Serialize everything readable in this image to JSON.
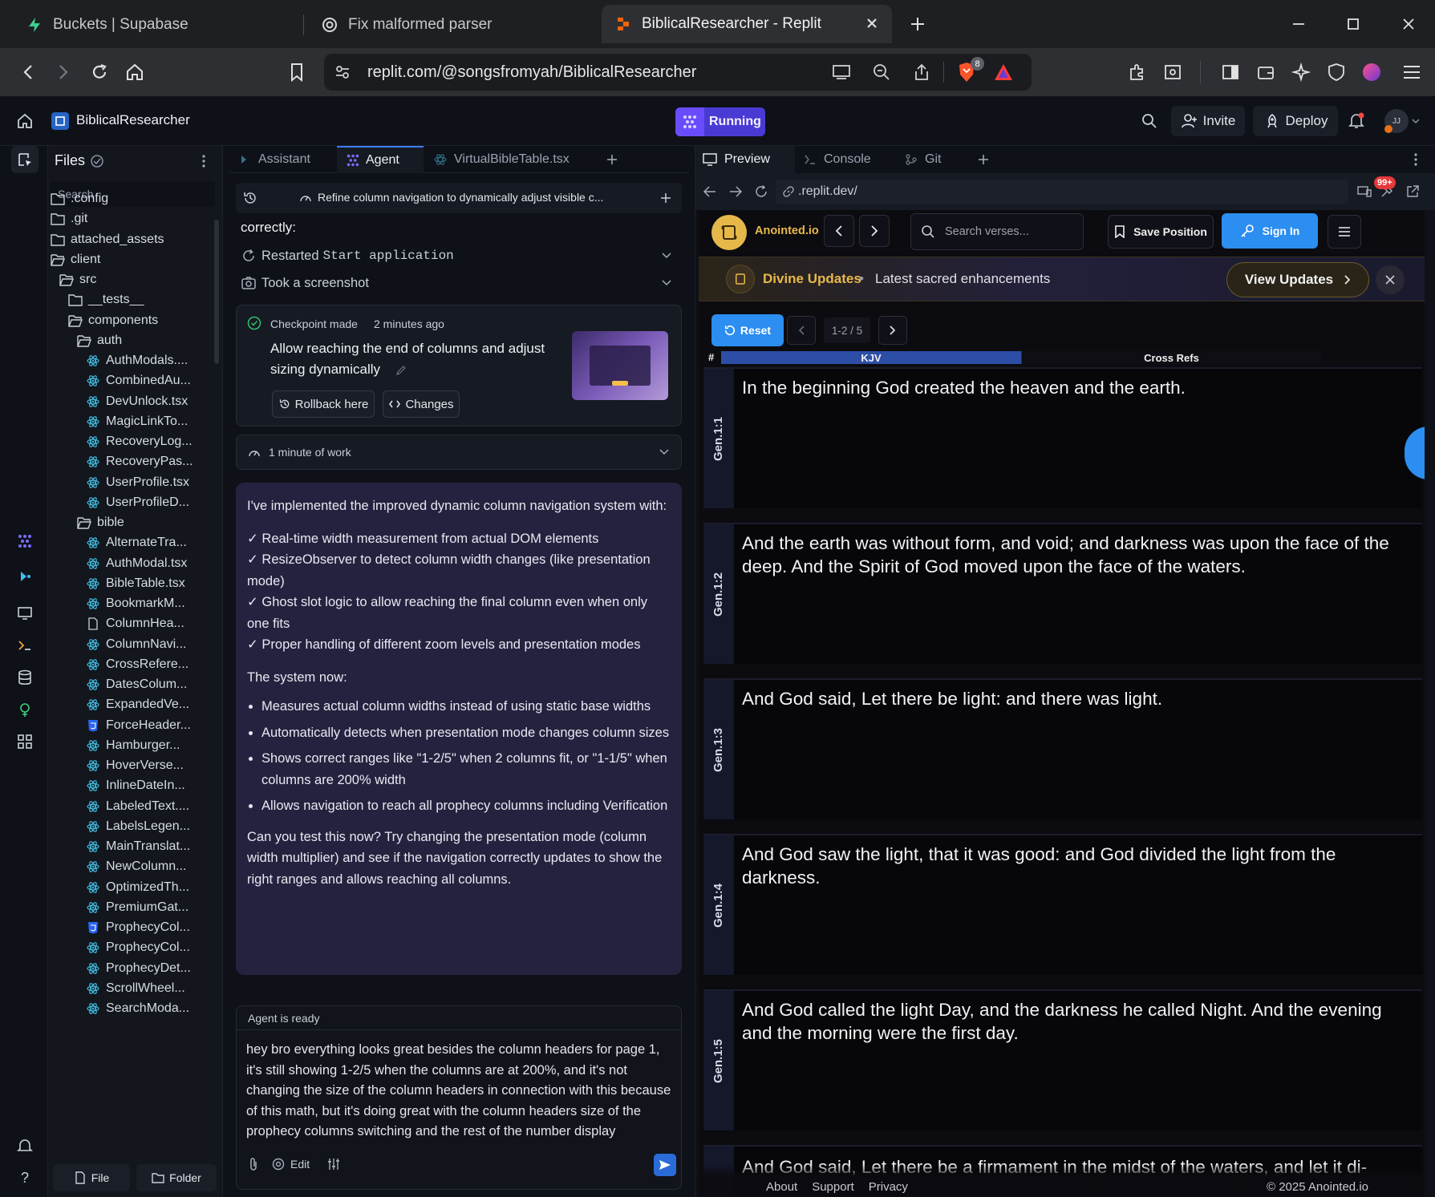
{
  "browser": {
    "tabs": [
      {
        "label": "Buckets | Supabase"
      },
      {
        "label": "Fix malformed parser"
      },
      {
        "label": "BiblicalResearcher - Replit"
      }
    ],
    "url": "replit.com/@songsfromyah/BiblicalResearcher",
    "brave_badge": "8"
  },
  "replit": {
    "project_name": "BiblicalResearcher",
    "run_label": "Running",
    "invite_label": "Invite",
    "deploy_label": "Deploy",
    "avatar_initials": "JJ"
  },
  "files": {
    "title": "Files",
    "search_placeholder": "Search",
    "items": [
      {
        "name": ".config",
        "type": "folder"
      },
      {
        "name": ".git",
        "type": "folder"
      },
      {
        "name": "attached_assets",
        "type": "folder"
      },
      {
        "name": "client",
        "type": "folder-open"
      },
      {
        "name": "src",
        "type": "folder-open"
      },
      {
        "name": "__tests__",
        "type": "folder"
      },
      {
        "name": "components",
        "type": "folder-open"
      },
      {
        "name": "auth",
        "type": "folder-open"
      },
      {
        "name": "AuthModals....",
        "type": "react"
      },
      {
        "name": "CombinedAu...",
        "type": "react"
      },
      {
        "name": "DevUnlock.tsx",
        "type": "react"
      },
      {
        "name": "MagicLinkTo...",
        "type": "react"
      },
      {
        "name": "RecoveryLog...",
        "type": "react"
      },
      {
        "name": "RecoveryPas...",
        "type": "react"
      },
      {
        "name": "UserProfile.tsx",
        "type": "react"
      },
      {
        "name": "UserProfileD...",
        "type": "react"
      },
      {
        "name": "bible",
        "type": "folder-open"
      },
      {
        "name": "AlternateTra...",
        "type": "react"
      },
      {
        "name": "AuthModal.tsx",
        "type": "react"
      },
      {
        "name": "BibleTable.tsx",
        "type": "react"
      },
      {
        "name": "BookmarkM...",
        "type": "react"
      },
      {
        "name": "ColumnHea...",
        "type": "file"
      },
      {
        "name": "ColumnNavi...",
        "type": "react"
      },
      {
        "name": "CrossRefere...",
        "type": "react"
      },
      {
        "name": "DatesColum...",
        "type": "react"
      },
      {
        "name": "ExpandedVe...",
        "type": "react"
      },
      {
        "name": "ForceHeader...",
        "type": "css"
      },
      {
        "name": "Hamburger...",
        "type": "react"
      },
      {
        "name": "HoverVerse...",
        "type": "react"
      },
      {
        "name": "InlineDateIn...",
        "type": "react"
      },
      {
        "name": "LabeledText....",
        "type": "react"
      },
      {
        "name": "LabelsLegen...",
        "type": "react"
      },
      {
        "name": "MainTranslat...",
        "type": "react"
      },
      {
        "name": "NewColumn...",
        "type": "react"
      },
      {
        "name": "OptimizedTh...",
        "type": "react"
      },
      {
        "name": "PremiumGat...",
        "type": "react"
      },
      {
        "name": "ProphecyCol...",
        "type": "css"
      },
      {
        "name": "ProphecyCol...",
        "type": "react"
      },
      {
        "name": "ProphecyDet...",
        "type": "react"
      },
      {
        "name": "ScrollWheel...",
        "type": "react"
      },
      {
        "name": "SearchModa...",
        "type": "react"
      }
    ],
    "new_file_label": "File",
    "new_folder_label": "Folder"
  },
  "agent": {
    "tabs": [
      "Assistant",
      "Agent",
      "VirtualBibleTable.tsx"
    ],
    "thread_title": "Refine column navigation to dynamically adjust visible c...",
    "correctly": "correctly:",
    "actions": [
      {
        "prefix": "Restarted ",
        "code": "Start application"
      },
      {
        "prefix": "Took a screenshot",
        "code": ""
      }
    ],
    "checkpoint": {
      "label": "Checkpoint made",
      "time": "2 minutes ago",
      "description": "Allow reaching the end of columns and adjust sizing dynamically",
      "rollback_label": "Rollback here",
      "changes_label": "Changes"
    },
    "work_label": "1 minute of work",
    "message": {
      "intro": "I've implemented the improved dynamic column navigation system with:",
      "checks": [
        "✓ Real-time width measurement from actual DOM elements",
        "✓ ResizeObserver to detect column width changes (like presentation mode)",
        "✓ Ghost slot logic to allow reaching the final column even when only one fits",
        "✓ Proper handling of different zoom levels and presentation modes"
      ],
      "system_now": "The system now:",
      "bullets": [
        "Measures actual column widths instead of using static base widths",
        "Automatically detects when presentation mode changes column sizes",
        "Shows correct ranges like \"1-2/5\" when 2 columns fit, or \"1-1/5\" when columns are 200% width",
        "Allows navigation to reach all prophecy columns including Verification"
      ],
      "closing": "Can you test this now? Try changing the presentation mode (column width multiplier) and see if the navigation correctly updates to show the right ranges and allows reaching all columns."
    },
    "status": "Agent is ready",
    "input_text": "hey bro everything looks great besides the column headers for page 1, it's still showing 1-2/5 when the columns are at 200%, and it's not changing the size of the column headers in connection with this because of this math, but it's doing great with the column headers size of the prophecy columns switching and the rest of the number display",
    "edit_label": "Edit"
  },
  "preview": {
    "tabs": [
      "Preview",
      "Console",
      "Git"
    ],
    "url": ".replit.dev/",
    "badge": "99+",
    "site": {
      "brand": "Anointed.io",
      "search_placeholder": "Search verses...",
      "save_label": "Save Position",
      "signin_label": "Sign In",
      "banner_title": "Divine Updates",
      "banner_sep": "•",
      "banner_text": "Latest sacred enhancements",
      "banner_button": "View Updates",
      "reset_label": "Reset",
      "page_range": "1-2 / 5",
      "col_hash": "#",
      "col_kjv": "KJV",
      "col_xref": "Cross Refs",
      "verses": [
        {
          "ref": "Gen.1:1",
          "text": "In the beginning God created the heaven and the earth."
        },
        {
          "ref": "Gen.1:2",
          "text": "And the earth was without form, and void; and darkness was upon the face of the deep. And the Spirit of God moved upon the face of the waters."
        },
        {
          "ref": "Gen.1:3",
          "text": "And God said, Let there be light: and there was light."
        },
        {
          "ref": "Gen.1:4",
          "text": "And God saw the light, that it was good: and God divided the light from the darkness."
        },
        {
          "ref": "Gen.1:5",
          "text": "And God called the light Day, and the darkness he called Night. And the evening and the morning were the first day."
        }
      ],
      "partial_verse": "And God said, Let there be a firmament in the midst of the waters, and let it di-",
      "footer_links": [
        "About",
        "Support",
        "Privacy"
      ],
      "copyright": "© 2025 Anointed.io"
    }
  },
  "colors": {
    "accent_purple": "#6a4cff",
    "signin_blue": "#2b8ef0",
    "banner_gold": "#e8b84a",
    "message_bg": "#24233f"
  }
}
